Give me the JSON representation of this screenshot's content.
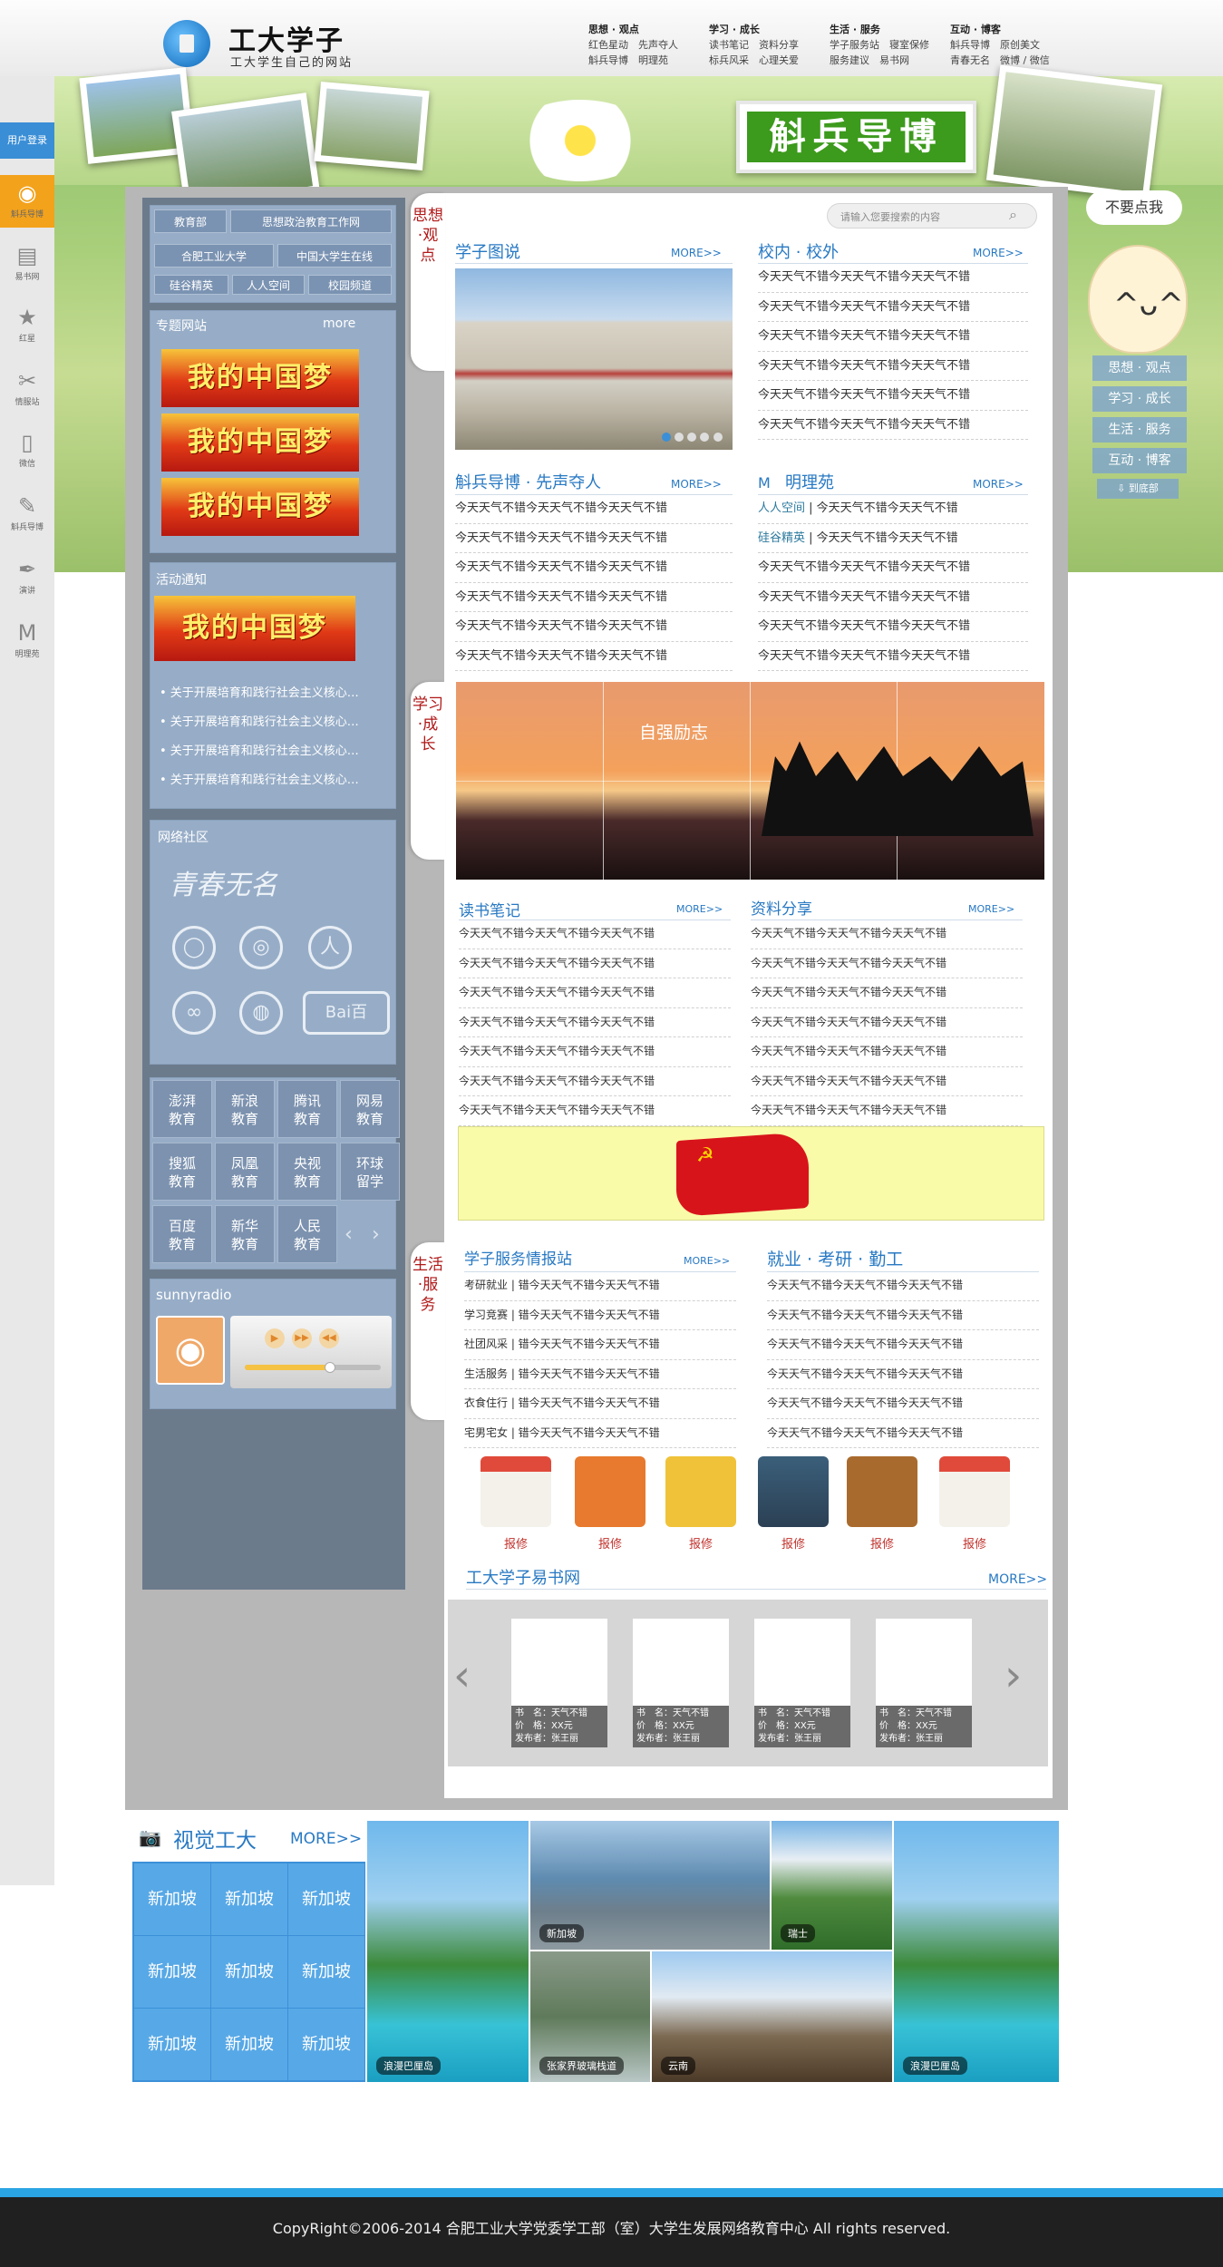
{
  "header": {
    "logo_title": "工大学子",
    "logo_sub": "工大学生自己的网站",
    "nav": [
      {
        "title": "思想 · 观点",
        "row1": "红色星动　先声夺人",
        "row2": "斛兵导博　明理苑"
      },
      {
        "title": "学习 · 成长",
        "row1": "读书笔记　资料分享",
        "row2": "标兵风采　心理关爱"
      },
      {
        "title": "生活 · 服务",
        "row1": "学子服务站　寝室保修",
        "row2": "服务建议　易书网"
      },
      {
        "title": "互动 · 博客",
        "row1": "斛兵导博　原创美文",
        "row2": "青春无名　微博 / 微信"
      }
    ]
  },
  "banner": {
    "plaque": "斛兵导博"
  },
  "leftbar": {
    "login": "用户登录",
    "items": [
      {
        "icon": "badge-icon",
        "label": "斛兵导博"
      },
      {
        "icon": "book-icon",
        "label": "易书网"
      },
      {
        "icon": "star-icon",
        "label": "红星"
      },
      {
        "icon": "tools-icon",
        "label": "情服站"
      },
      {
        "icon": "phone-icon",
        "label": "微信"
      },
      {
        "icon": "edit-icon",
        "label": "斛兵导博"
      },
      {
        "icon": "pen-icon",
        "label": "演讲"
      },
      {
        "icon": "m-icon",
        "label": "明理苑"
      }
    ]
  },
  "leftpanel": {
    "links": [
      "教育部",
      "思想政治教育工作网",
      "合肥工业大学",
      "中国大学生在线",
      "硅谷精英",
      "人人空间",
      "校园频道"
    ],
    "special_title": "专题网站",
    "special_more": "more",
    "dream": "我的中国梦",
    "notice_title": "活动通知",
    "notices": [
      "• 关于开展培育和践行社会主义核心…",
      "• 关于开展培育和践行社会主义核心…",
      "• 关于开展培育和践行社会主义核心…",
      "• 关于开展培育和践行社会主义核心…"
    ],
    "community_title": "网络社区",
    "community_logo": "青春无名",
    "edu": [
      [
        "澎湃",
        "教育"
      ],
      [
        "新浪",
        "教育"
      ],
      [
        "腾讯",
        "教育"
      ],
      [
        "网易",
        "教育"
      ],
      [
        "搜狐",
        "教育"
      ],
      [
        "凤凰",
        "教育"
      ],
      [
        "央视",
        "教育"
      ],
      [
        "环球",
        "留学"
      ],
      [
        "百度",
        "教育"
      ],
      [
        "新华",
        "教育"
      ],
      [
        "人民",
        "教育"
      ]
    ],
    "radio_title": "sunnyradio"
  },
  "main": {
    "search_placeholder": "请输入您要搜索的内容",
    "tabs": [
      "思想·观点",
      "学习·成长",
      "生活·服务"
    ],
    "more": "MORE>>",
    "s1_title": "学子图说",
    "s2_title": "校内 · 校外",
    "s3_title": "斛兵导博 · 先声夺人",
    "s4_title": "明理苑",
    "line": "今天天气不错今天天气不错今天天气不错",
    "mingli": [
      {
        "tag": "人人空间",
        "text": " | 今天天气不错今天天气不错"
      },
      {
        "tag": "硅谷精英",
        "text": " | 今天天气不错今天天气不错"
      }
    ],
    "sunset_caption": "自强励志",
    "s5_title": "读书笔记",
    "s6_title": "资料分享",
    "s7_title": "学子服务情报站",
    "s8_title": "就业 · 考研 · 勤工",
    "service_lines": [
      "考研就业 | 错今天天气不错今天天气不错",
      "学习竞赛 | 错今天天气不错今天天气不错",
      "社团风采 | 错今天天气不错今天天气不错",
      "生活服务 | 错今天天气不错今天天气不错",
      "衣食住行 | 错今天天气不错今天天气不错",
      "宅男宅女 | 错今天天气不错今天天气不错"
    ],
    "service_label": "报修",
    "s9_title": "工大学子易书网",
    "book_caption": [
      "书　名：天气不错",
      "价　格：XX元",
      "发布者：张王丽"
    ]
  },
  "visual": {
    "title": "视觉工大",
    "more": "MORE>>",
    "grid_label": "新加坡",
    "captions": [
      "浪漫巴厘岛",
      "新加坡",
      "瑞士",
      "张家界玻璃栈道",
      "云南",
      "浪漫巴厘岛"
    ]
  },
  "right": {
    "dont_click": "不要点我",
    "nav": [
      "思想 · 观点",
      "学习 · 成长",
      "生活 · 服务",
      "互动 · 博客"
    ],
    "bottom": "⇩ 到底部"
  },
  "footer": {
    "text": "CopyRight©2006-2014 合肥工业大学党委学工部（室）大学生发展网络教育中心 All rights reserved."
  }
}
